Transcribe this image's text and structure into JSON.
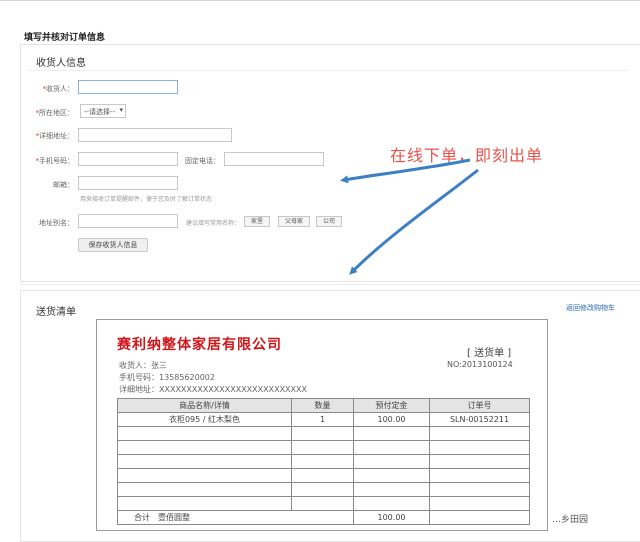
{
  "page": {
    "title": "填写并核对订单信息"
  },
  "receiver": {
    "section_title": "收货人信息",
    "name_label": "收货人：",
    "region_label": "所在地区：",
    "region_select": "--请选择--",
    "address_label": "详细地址：",
    "mobile_label": "手机号码：",
    "phone_label": "固定电话：",
    "email_label": "邮箱：",
    "email_hint": "用来接收订单提醒邮件，便于您及时了解订单状态",
    "alias_label": "地址别名：",
    "alias_hint": "建议填写常用名称：",
    "alias_tags": [
      "家里",
      "父母家",
      "公司"
    ],
    "save_button": "保存收货人信息"
  },
  "annotation": {
    "text": "在线下单，即刻出单",
    "color": "#e8524b"
  },
  "delivery": {
    "section_title": "送货清单",
    "back_link": "返回修改购物车",
    "company": "赛利纳整体家居有限公司",
    "doc_label": "[ 送货单 ]",
    "doc_no": "NO:2013100124",
    "recipient": "收货人：张三",
    "mobile": "手机号码：13585620002",
    "address": "详细地址：XXXXXXXXXXXXXXXXXXXXXXXXXXX",
    "table": {
      "headers": [
        "商品名称/详情",
        "数量",
        "预付定金",
        "订单号"
      ],
      "rows": [
        [
          "衣柜095 / 红木梨色",
          "1",
          "100.00",
          "SLN-00152211"
        ],
        [
          "",
          "",
          "",
          ""
        ],
        [
          "",
          "",
          "",
          ""
        ],
        [
          "",
          "",
          "",
          ""
        ],
        [
          "",
          "",
          "",
          ""
        ],
        [
          "",
          "",
          "",
          ""
        ],
        [
          "",
          "",
          "",
          ""
        ]
      ],
      "total_label": "合计　壹佰圆整",
      "total_amount": "100.00"
    }
  },
  "watermark": "…乡田园"
}
